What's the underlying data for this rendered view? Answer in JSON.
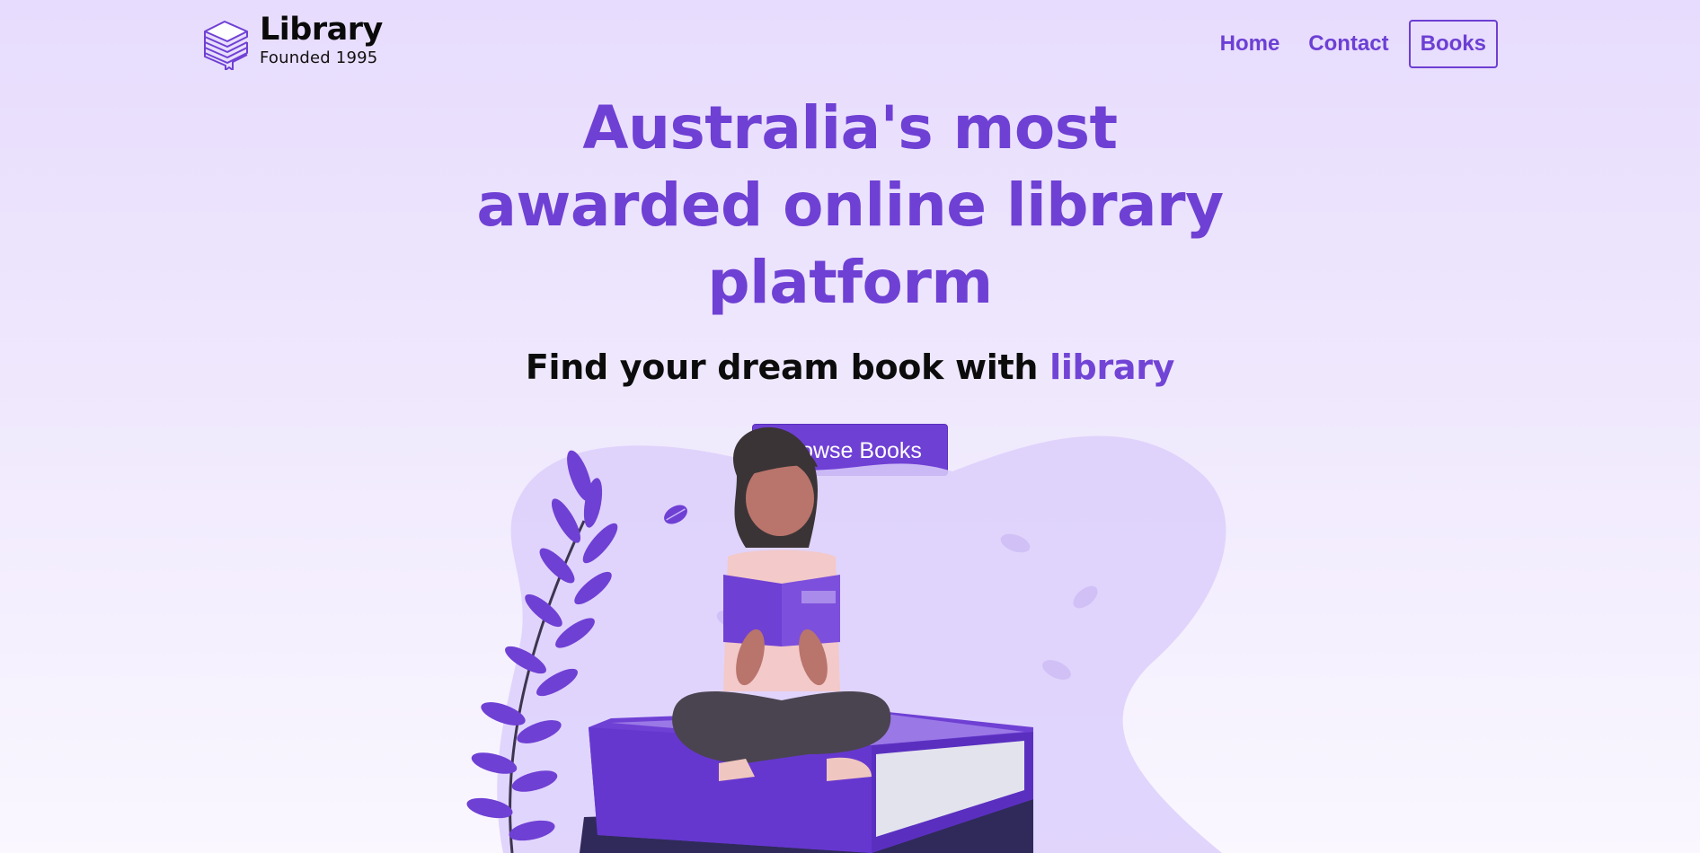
{
  "brand": {
    "title": "Library",
    "subtitle": "Founded 1995",
    "logo_icon": "books-stack-icon"
  },
  "nav": {
    "items": [
      {
        "label": "Home",
        "active": false
      },
      {
        "label": "Contact",
        "active": false
      },
      {
        "label": "Books",
        "active": true
      }
    ]
  },
  "hero": {
    "title": "Australia's most awarded online library platform",
    "subtitle_prefix": "Find your dream book with ",
    "subtitle_accent": "library",
    "cta_label": "Browse Books"
  },
  "illustration": {
    "name": "woman-reading-on-books-illustration"
  },
  "colors": {
    "accent": "#6f40d4",
    "background_top": "#e7dcfd",
    "background_bottom": "#faf7ff",
    "text_dark": "#0c0c0c"
  }
}
